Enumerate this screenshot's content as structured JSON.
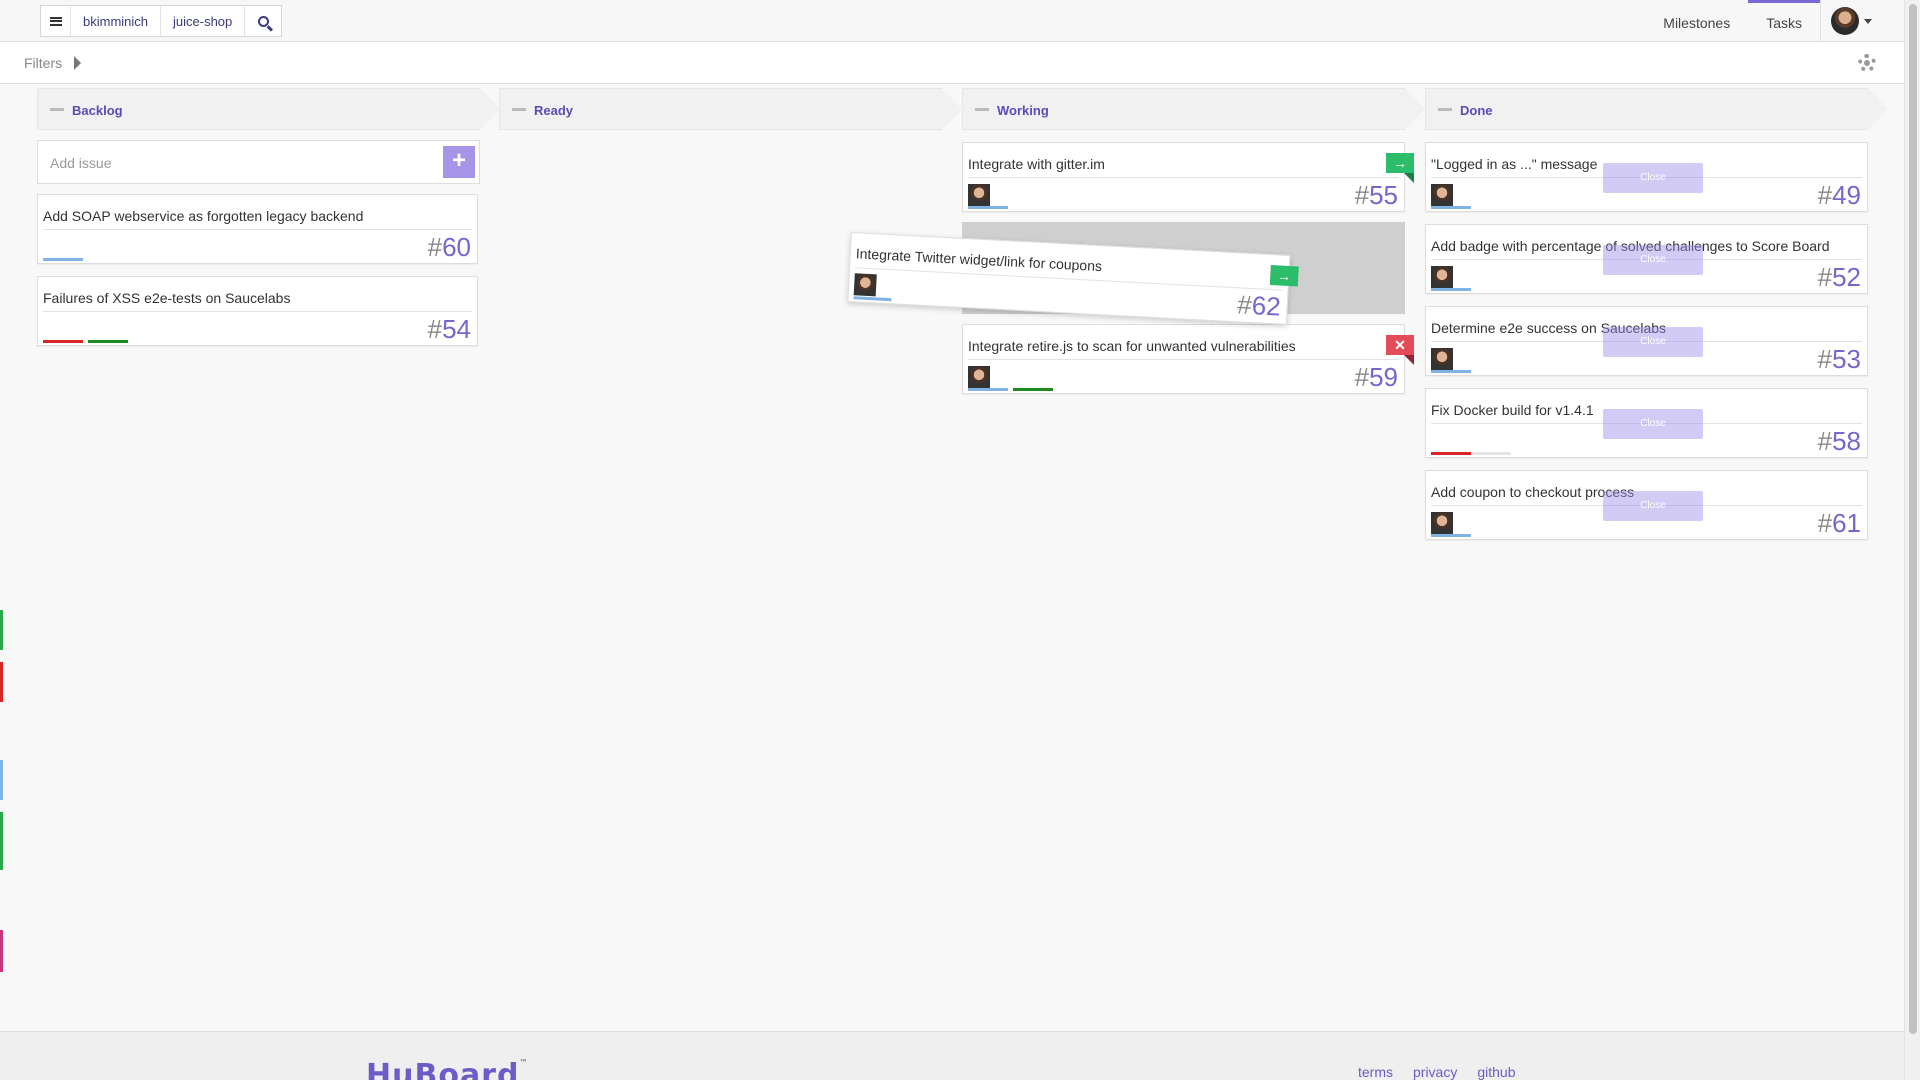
{
  "topbar": {
    "user": "bkimminich",
    "repo": "juice-shop",
    "nav": {
      "milestones": "Milestones",
      "tasks": "Tasks"
    }
  },
  "filters": {
    "label": "Filters"
  },
  "columns": [
    {
      "title": "Backlog"
    },
    {
      "title": "Ready"
    },
    {
      "title": "Working"
    },
    {
      "title": "Done"
    }
  ],
  "backlog": {
    "add_placeholder": "Add issue",
    "add_icon": "+",
    "cards": [
      {
        "title": "Add SOAP webservice as forgotten legacy backend",
        "hash": "#",
        "num": "60"
      },
      {
        "title": "Failures of XSS e2e-tests on Saucelabs",
        "hash": "#",
        "num": "54"
      }
    ]
  },
  "working": {
    "cards": [
      {
        "title": "Integrate with gitter.im",
        "hash": "#",
        "num": "55",
        "flag": "ready",
        "flag_icon": "→"
      },
      {
        "title": "Integrate retire.js to scan for unwanted vulnerabilities",
        "hash": "#",
        "num": "59",
        "flag": "blocked",
        "flag_icon": "✕"
      }
    ],
    "dragging": {
      "title": "Integrate Twitter widget/link for coupons",
      "hash": "#",
      "num": "62",
      "flag_icon": "→"
    }
  },
  "done": {
    "close_label": "Close",
    "cards": [
      {
        "title": "\"Logged in as ...\" message",
        "hash": "#",
        "num": "49"
      },
      {
        "title": "Add badge with percentage of solved challenges to Score Board",
        "hash": "#",
        "num": "52"
      },
      {
        "title": "Determine e2e success on Saucelabs",
        "hash": "#",
        "num": "53"
      },
      {
        "title": "Fix Docker build for v1.4.1",
        "hash": "#",
        "num": "58"
      },
      {
        "title": "Add coupon to checkout process",
        "hash": "#",
        "num": "61"
      }
    ]
  },
  "footer": {
    "logo": "HuBoard",
    "links": {
      "terms": "terms",
      "privacy": "privacy",
      "github": "github"
    }
  },
  "colors": {
    "accent": "#7766cc",
    "green": "#2bbd6a",
    "red": "#e24b57"
  }
}
